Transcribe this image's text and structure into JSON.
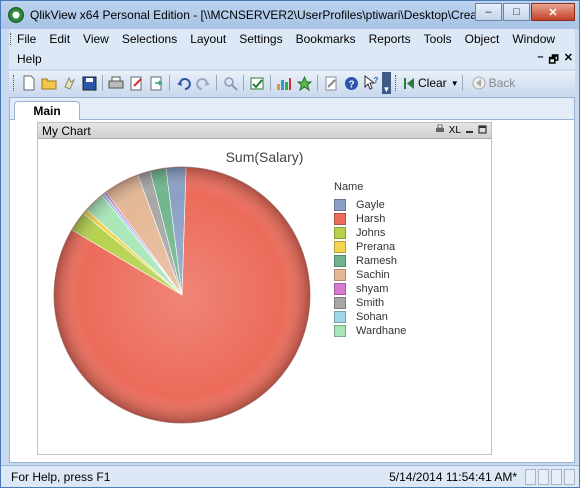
{
  "window": {
    "title": "QlikView x64 Personal Edition - [\\\\MCNSERVER2\\UserProfiles\\ptiwari\\Desktop\\CreateChart.q...",
    "minimize_glyph": "–",
    "maximize_glyph": "□",
    "close_glyph": "✕"
  },
  "menu": {
    "items": [
      "File",
      "Edit",
      "View",
      "Selections",
      "Layout",
      "Settings",
      "Bookmarks",
      "Reports",
      "Tools",
      "Object",
      "Window"
    ],
    "help_label": "Help",
    "mdi_minimize": "–",
    "mdi_restore": "🗗",
    "mdi_close": "✕"
  },
  "toolbar": {
    "icons": [
      "new-file-icon",
      "open-folder-icon",
      "reload-icon",
      "save-icon",
      "print-icon",
      "edit-script-icon",
      "reload-data-icon",
      "undo-icon",
      "redo-icon",
      "search-icon",
      "selection-icon",
      "chart-icon",
      "bookmark-star-icon",
      "notes-icon",
      "help-icon",
      "context-help-icon"
    ],
    "clear_label": "Clear",
    "back_label": "Back"
  },
  "workspace": {
    "tabs": [
      {
        "label": "Main"
      }
    ]
  },
  "chart_object": {
    "caption": "My Chart",
    "caption_icons": [
      "print-icon",
      "XL",
      "minimize-icon",
      "maximize-icon"
    ]
  },
  "chart_data": {
    "type": "pie",
    "title": "Sum(Salary)",
    "legend_title": "Name",
    "legend_position": "right",
    "categories": [
      "Gayle",
      "Harsh",
      "Johns",
      "Prerana",
      "Ramesh",
      "Sachin",
      "shyam",
      "Smith",
      "Sohan",
      "Wardhane"
    ],
    "values": [
      2.5,
      83,
      2.5,
      0.6,
      2.0,
      4.5,
      0.3,
      1.6,
      0.4,
      2.6
    ],
    "colors": [
      "#8aa0c4",
      "#ec6b5a",
      "#b6d14e",
      "#f2d54a",
      "#6fb58d",
      "#e5b896",
      "#d97ad2",
      "#a7a7a7",
      "#9fd6e8",
      "#a8e6b8"
    ]
  },
  "status": {
    "help_text": "For Help, press F1",
    "timestamp": "5/14/2014 11:54:41 AM*"
  }
}
